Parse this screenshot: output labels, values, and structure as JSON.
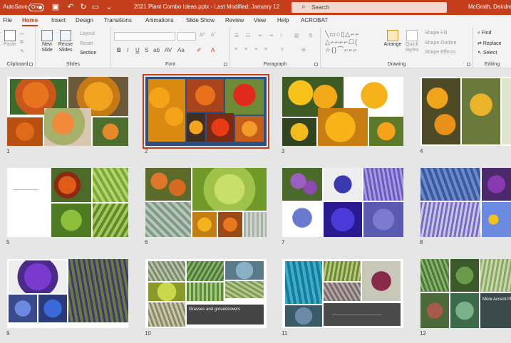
{
  "titlebar": {
    "autosave_label": "AutoSave",
    "autosave_state": "On",
    "document_title": "2021 Plant Combo Ideas.pptx  -  Last Modified: January 12",
    "search_placeholder": "Search",
    "user_name": "McGrath, Deirdre",
    "color": "#c43e1c"
  },
  "quick_access": {
    "icons": [
      "save-icon",
      "undo-icon",
      "redo-icon",
      "present-icon",
      "customize-icon"
    ]
  },
  "tabs": [
    "File",
    "Home",
    "Insert",
    "Design",
    "Transitions",
    "Animations",
    "Slide Show",
    "Review",
    "View",
    "Help",
    "ACROBAT"
  ],
  "active_tab": "Home",
  "ribbon": {
    "clipboard": {
      "paste_label": "Paste",
      "group_label": "Clipboard"
    },
    "slides": {
      "new_slide": "New Slide",
      "reuse_slides": "Reuse Slides",
      "layout": "Layout",
      "reset": "Reset",
      "section": "Section",
      "group_label": "Slides"
    },
    "font": {
      "group_label": "Font",
      "bold": "B",
      "italic": "I",
      "underline": "U",
      "strike": "S",
      "shadow": "ab",
      "spacing": "AV",
      "case": "Aa"
    },
    "paragraph": {
      "group_label": "Paragraph"
    },
    "drawing": {
      "arrange": "Arrange",
      "quick_styles": "Quick Styles",
      "shape_fill": "Shape Fill",
      "shape_outline": "Shape Outline",
      "shape_effects": "Shape Effects",
      "group_label": "Drawing"
    },
    "editing": {
      "find": "Find",
      "replace": "Replace",
      "select": "Select",
      "group_label": "Editing"
    }
  },
  "slides": [
    {
      "number": "1"
    },
    {
      "number": "2"
    },
    {
      "number": "3"
    },
    {
      "number": "4"
    },
    {
      "number": "5"
    },
    {
      "number": "6"
    },
    {
      "number": "7"
    },
    {
      "number": "8"
    },
    {
      "number": "9"
    },
    {
      "number": "10",
      "caption": "Grasses and groundcovers"
    },
    {
      "number": "11"
    },
    {
      "number": "12",
      "caption": "More Accent Pl..."
    }
  ],
  "selected_slide": "2"
}
